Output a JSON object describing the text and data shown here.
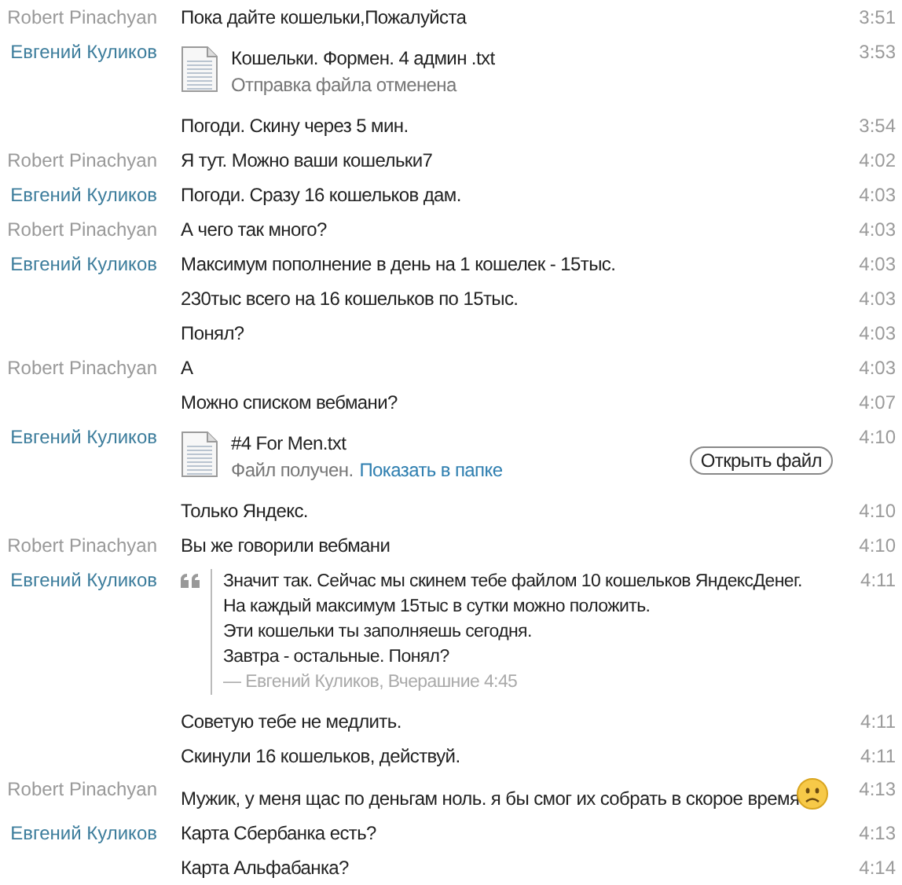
{
  "messages": [
    {
      "kind": "text",
      "sender": {
        "name": "Robert Pinachyan",
        "color": "#999999"
      },
      "text": "Пока дайте кошельки,Пожалуйста",
      "time": "3:51"
    },
    {
      "kind": "file",
      "sender": {
        "name": "Евгений Куликов",
        "color": "#3d7d9c"
      },
      "file_name": "Кошельки. Формен. 4 админ .txt",
      "status": "Отправка файла отменена",
      "time": "3:53"
    },
    {
      "kind": "text",
      "text": "Погоди. Скину через 5 мин.",
      "time": "3:54"
    },
    {
      "kind": "text",
      "sender": {
        "name": "Robert Pinachyan",
        "color": "#999999"
      },
      "text": "Я тут. Можно ваши кошельки7",
      "time": "4:02"
    },
    {
      "kind": "text",
      "sender": {
        "name": "Евгений Куликов",
        "color": "#3d7d9c"
      },
      "text": "Погоди. Сразу 16 кошельков дам.",
      "time": "4:03"
    },
    {
      "kind": "text",
      "sender": {
        "name": "Robert Pinachyan",
        "color": "#999999"
      },
      "text": "А чего так много?",
      "time": "4:03"
    },
    {
      "kind": "text",
      "sender": {
        "name": "Евгений Куликов",
        "color": "#3d7d9c"
      },
      "text": "Максимум пополнение в день на 1 кошелек - 15тыс.",
      "time": "4:03"
    },
    {
      "kind": "text",
      "text": "230тыс всего на 16 кошельков по 15тыс.",
      "time": "4:03"
    },
    {
      "kind": "text",
      "text": "Понял?",
      "time": "4:03"
    },
    {
      "kind": "text",
      "sender": {
        "name": "Robert Pinachyan",
        "color": "#999999"
      },
      "text": "А",
      "time": "4:03"
    },
    {
      "kind": "text",
      "text": "Можно списком вебмани?",
      "time": "4:07"
    },
    {
      "kind": "file",
      "sender": {
        "name": "Евгений Куликов",
        "color": "#3d7d9c"
      },
      "file_name": "#4 For Men.txt",
      "status": "Файл получен.",
      "link": "Показать в папке",
      "button": "Открыть файл",
      "time": "4:10"
    },
    {
      "kind": "text",
      "text": "Только Яндекс.",
      "time": "4:10"
    },
    {
      "kind": "text",
      "sender": {
        "name": "Robert Pinachyan",
        "color": "#999999"
      },
      "text": "Вы же говорили вебмани",
      "time": "4:10"
    },
    {
      "kind": "quote",
      "sender": {
        "name": "Евгений Куликов",
        "color": "#3d7d9c"
      },
      "lines": [
        "Значит так. Сейчас мы скинем тебе файлом 10 кошельков ЯндексДенег.",
        "На каждый максимум 15тыс в сутки можно положить.",
        "Эти кошельки ты заполняешь сегодня.",
        "Завтра - остальные. Понял?"
      ],
      "attribution": "— Евгений Куликов, Вчерашние 4:45",
      "time": "4:11"
    },
    {
      "kind": "text",
      "text": "Советую тебе не медлить.",
      "time": "4:11"
    },
    {
      "kind": "text",
      "text": "Скинули 16 кошельков, действуй.",
      "time": "4:11"
    },
    {
      "kind": "text",
      "sender": {
        "name": "Robert Pinachyan",
        "color": "#999999"
      },
      "text": "Мужик, у меня щас по деньгам ноль. я бы смог их собрать в скорое время",
      "emoji": true,
      "time": "4:13"
    },
    {
      "kind": "text",
      "sender": {
        "name": "Евгений Куликов",
        "color": "#3d7d9c"
      },
      "text": "Карта Сбербанка есть?",
      "time": "4:13"
    },
    {
      "kind": "text",
      "text": "Карта Альфабанка?",
      "time": "4:14"
    }
  ]
}
